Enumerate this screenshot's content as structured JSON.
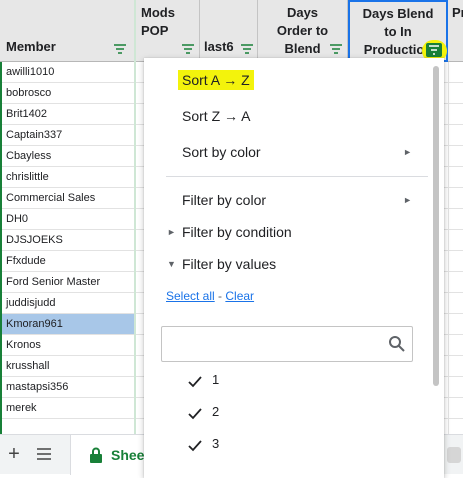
{
  "columns": {
    "member": "Member",
    "mods_pop": "Mods\nPOP",
    "last6": "last6",
    "days_order_blend": "Days\nOrder to\nBlend",
    "days_blend_production": "Days Blend\nto In\nProduction",
    "next_partial": "Pr"
  },
  "members": [
    "awilli1010",
    "bobrosco",
    "Brit1402",
    "Captain337",
    "Cbayless",
    "chrislittle",
    "Commercial Sales",
    "DH0",
    "DJSJOEKS",
    "Ffxdude",
    "Ford Senior Master",
    "juddisjudd",
    "Kmoran961",
    "Kronos",
    "krusshall",
    "mastapsi356",
    "merek"
  ],
  "selected_member": "Kmoran961",
  "menu": {
    "sort_az": "Sort A → Z",
    "sort_za": "Sort Z → A",
    "sort_by_color": "Sort by color",
    "filter_by_color": "Filter by color",
    "filter_by_condition": "Filter by condition",
    "filter_by_values": "Filter by values",
    "select_all": "Select all",
    "separator": " - ",
    "clear": "Clear",
    "search_value": "",
    "values": [
      "1",
      "2",
      "3"
    ]
  },
  "sheetbar": {
    "add_label": "+",
    "tab_label": "Shee"
  },
  "colors": {
    "highlight": "#f3f30c",
    "accent": "#1a73e8",
    "sheet_green": "#188038",
    "selected_cell": "#a8c7e8"
  }
}
